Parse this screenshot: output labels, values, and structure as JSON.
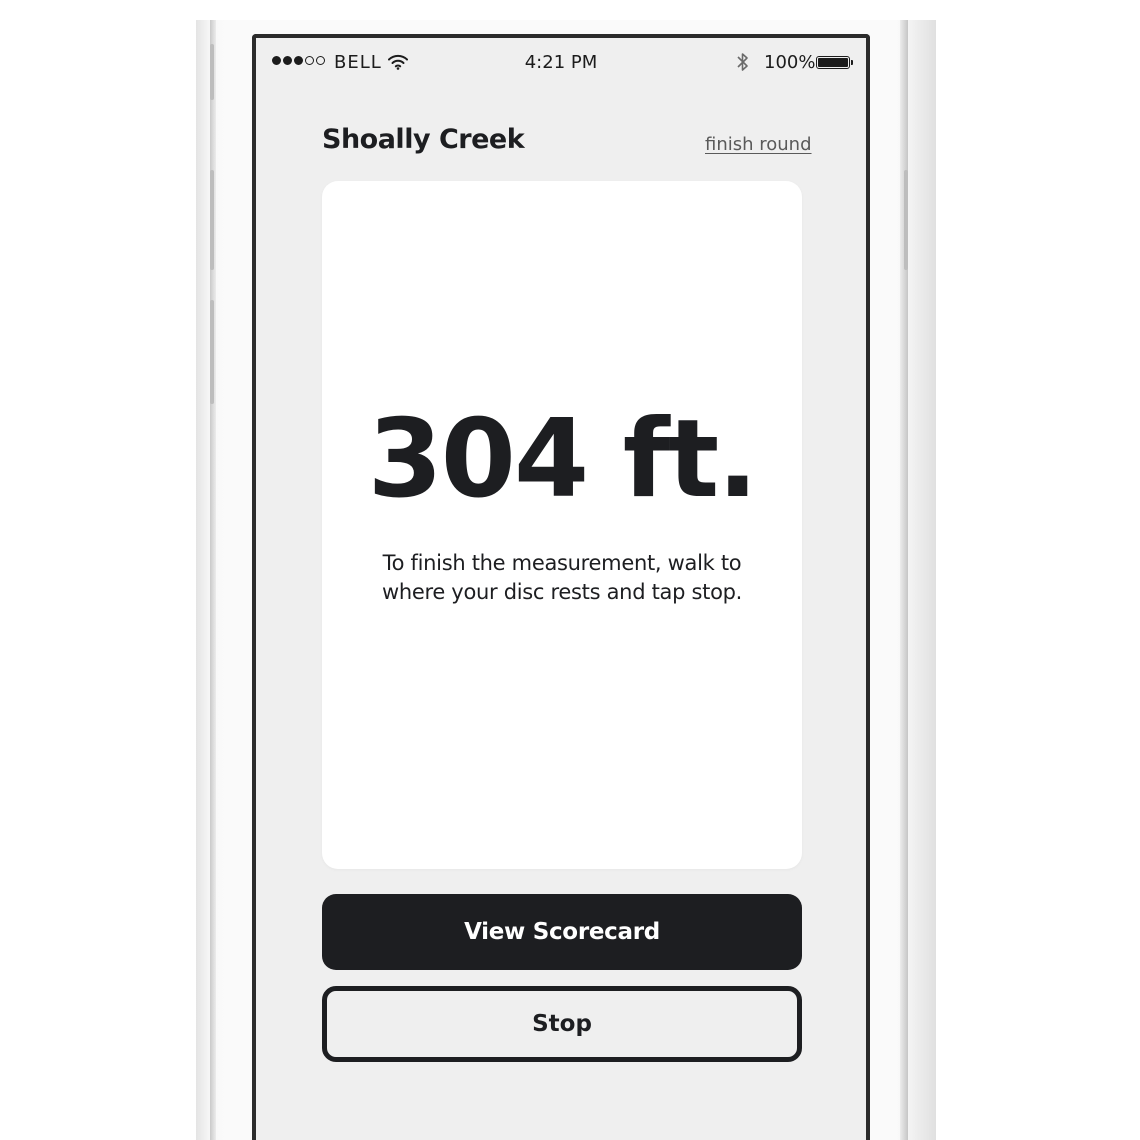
{
  "status_bar": {
    "carrier": "BELL",
    "signal_bars_filled": 3,
    "signal_bars_total": 5,
    "time": "4:21 PM",
    "battery_percent": "100%",
    "icons": [
      "signal-dots-icon",
      "wifi-icon",
      "bluetooth-icon",
      "battery-icon"
    ]
  },
  "header": {
    "course_name": "Shoally Creek",
    "finish_link": "finish round"
  },
  "measurement": {
    "distance": "304 ft.",
    "instruction": "To finish the measurement, walk to where your disc rests and tap stop."
  },
  "actions": {
    "primary_label": "View Scorecard",
    "secondary_label": "Stop"
  },
  "colors": {
    "screen_background": "#efefef",
    "card_background": "#ffffff",
    "text_dark": "#1d1e21",
    "link_gray": "#5a5a5a"
  }
}
